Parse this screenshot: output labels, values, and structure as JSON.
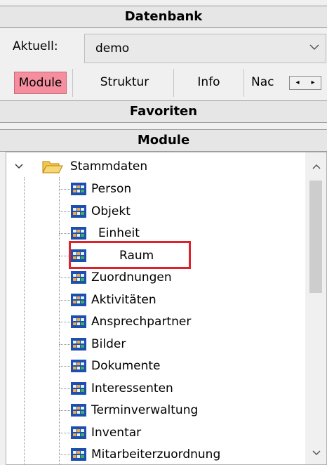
{
  "headers": {
    "datenbank": "Datenbank",
    "favoriten": "Favoriten",
    "module": "Module"
  },
  "aktuell": {
    "label": "Aktuell:",
    "value": "demo"
  },
  "tabs": [
    "Module",
    "Struktur",
    "Info",
    "Nac"
  ],
  "tree": {
    "root": "Stammdaten",
    "items": [
      "Person",
      "Objekt",
      "Einheit",
      "Raum",
      "Zuordnungen",
      "Aktivitäten",
      "Ansprechpartner",
      "Bilder",
      "Dokumente",
      "Interessenten",
      "Terminverwaltung",
      "Inventar",
      "Mitarbeiterzuordnung"
    ]
  },
  "colors": {
    "active_tab": "#f58fa0",
    "highlight": "#e0202a",
    "icon_blue": "#1c4fb0"
  }
}
